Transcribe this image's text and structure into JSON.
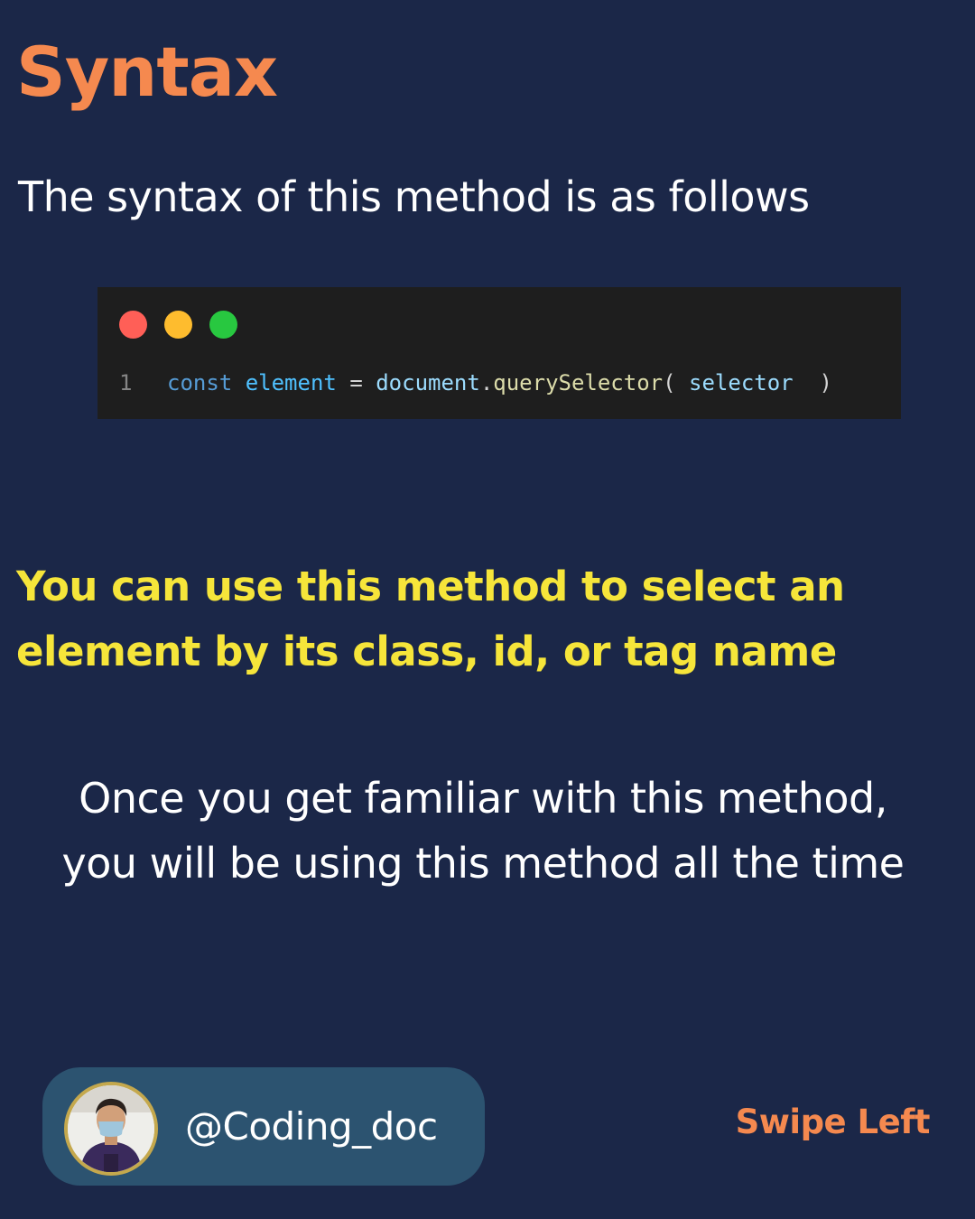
{
  "title": "Syntax",
  "subtitle": "The syntax of this method is as follows",
  "code": {
    "line_number": "1",
    "tokens": {
      "keyword": "const",
      "variable": "element",
      "operator": "=",
      "object": "document",
      "dot": ".",
      "method": "querySelector",
      "open_paren": "(",
      "param": "selector",
      "close_paren": ")"
    },
    "window_dots": [
      "red",
      "yellow",
      "green"
    ],
    "colors": {
      "red": "#ff5f57",
      "yellow": "#febc2e",
      "green": "#28c840",
      "background": "#1e1e1e"
    }
  },
  "highlight_text": " You can use this method to select an\nelement by its class, id, or tag name",
  "body_text": "Once you get familiar with this method,\nyou will be using this method all the time",
  "footer": {
    "handle": "@Coding_doc",
    "swipe_label": "Swipe Left"
  },
  "colors": {
    "background": "#1b2748",
    "title": "#f5894f",
    "highlight": "#f6e53a",
    "pill": "#2c5370"
  }
}
